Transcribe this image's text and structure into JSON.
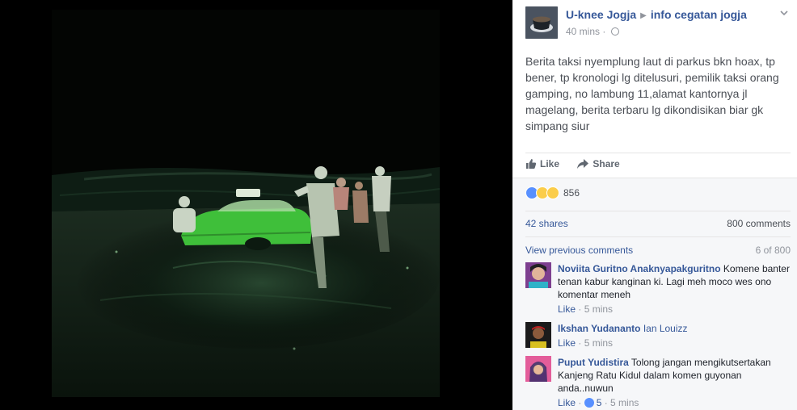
{
  "post": {
    "author": "U-knee Jogja",
    "group": "info cegatan jogja",
    "time": "40 mins",
    "text": "Berita taksi nyemplung laut di parkus bkn hoax, tp bener, tp kronologi lg ditelusuri, pemilik taksi orang gamping, no lambung 11,alamat kantornya jl magelang, berita terbaru lg dikondisikan biar gk simpang siur"
  },
  "actions": {
    "like": "Like",
    "share": "Share"
  },
  "feedback": {
    "reaction_count": "856",
    "shares": "42 shares",
    "comments_count": "800 comments",
    "view_previous": "View previous comments",
    "page_counter": "6 of 800"
  },
  "comments": [
    {
      "name": "Noviita Guritno Anaknyapakguritno",
      "text": "Komene banter tenan kabur kanginan ki. Lagi meh moco wes ono komentar meneh",
      "like": "Like",
      "time": "5 mins"
    },
    {
      "name": "Ikshan Yudananto",
      "tag": "Ian Louizz",
      "like": "Like",
      "time": "5 mins"
    },
    {
      "name": "Puput Yudistira",
      "text": "Tolong jangan mengikutsertakan Kanjeng Ratu Kidul dalam komen guyonan anda..nuwun",
      "like": "Like",
      "likes": "5",
      "time": "5 mins"
    }
  ],
  "colors": {
    "link": "#365899",
    "meta": "#90949c",
    "taxi_green": "#3fbf3a",
    "reaction_like": "#5890ff"
  },
  "icons": [
    "globe-icon",
    "chevron-down-icon",
    "like-thumb-icon",
    "share-arrow-icon",
    "like-reaction-icon",
    "wow-reaction-icon",
    "haha-reaction-icon"
  ]
}
